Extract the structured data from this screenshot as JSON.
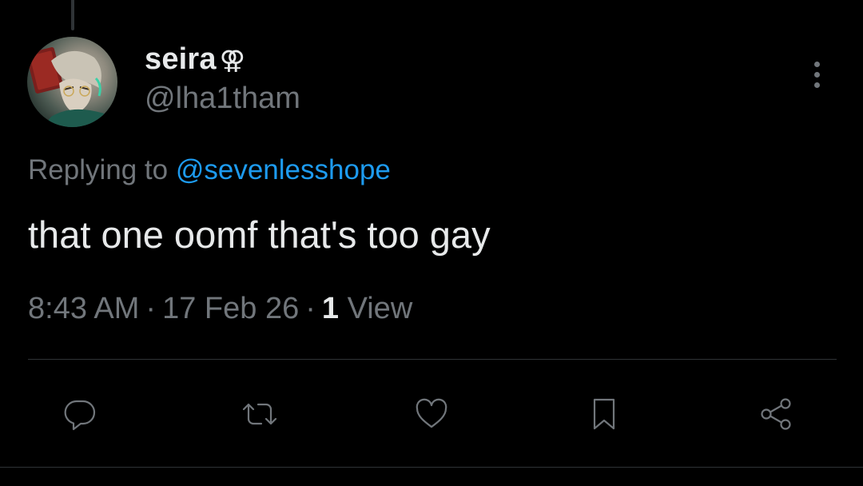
{
  "author": {
    "display_name": "seira",
    "name_emoji": "⚢",
    "handle": "@lha1tham"
  },
  "reply": {
    "prefix": "Replying to",
    "mention": "@sevenlesshope"
  },
  "tweet": {
    "text": "that one oomf that's too gay"
  },
  "meta": {
    "time": "8:43 AM",
    "date": "17 Feb 26",
    "separator": "·",
    "views_count": "1",
    "views_label": "View"
  },
  "actions": {
    "icons": [
      "reply-icon",
      "retweet-icon",
      "like-icon",
      "bookmark-icon",
      "share-icon"
    ]
  },
  "colors": {
    "background": "#000000",
    "primary_text": "#e7e9ea",
    "secondary_text": "#71767b",
    "link": "#1d9bf0",
    "divider": "#2f3336"
  }
}
